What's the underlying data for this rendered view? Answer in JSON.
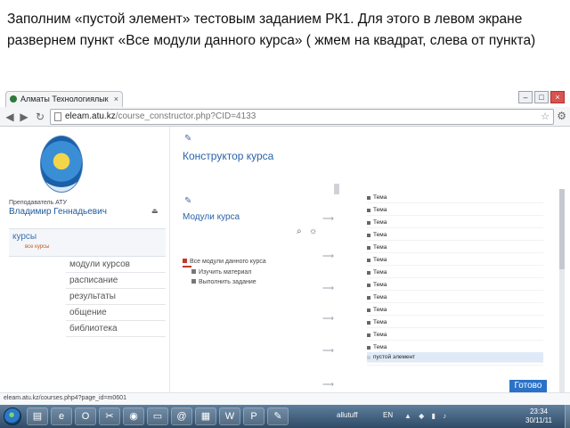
{
  "caption": {
    "line1": "Заполним «пустой элемент» тестовым заданием РК1. Для этого в левом экране",
    "line2": "развернем пункт «Все модули данного курса» (  жмем на квадрат, слева от пункта)"
  },
  "browser": {
    "tab_title": "Алматы Технологиялык",
    "url_host": "eleam.atu.kz",
    "url_path": "/course_constructor.php?CID=4133",
    "status_url": "eleam.atu.kz/courses.php4?page_id=m0601"
  },
  "left": {
    "teacher_label": "Преподаватель АТУ",
    "teacher_name": "Владимир Геннадьевич",
    "courses_title": "курсы",
    "courses_sub": "все курсы",
    "menu": [
      "модули курсов",
      "расписание",
      "результаты",
      "общение",
      "библиотека"
    ]
  },
  "middle": {
    "title": "Конструктор курса",
    "modules_title": "Модули курса",
    "tree": [
      "Все модули данного курса",
      "Изучить материал",
      "Выполнить задание"
    ]
  },
  "right": {
    "topics": [
      "Тема",
      "Тема",
      "Тема",
      "Тема",
      "Тема",
      "Тема",
      "Тема",
      "Тема",
      "Тема",
      "Тема",
      "Тема",
      "Тема",
      "Тема",
      "Тема"
    ],
    "empty_element": "пустой элемент",
    "done_button": "Готово"
  },
  "taskbar": {
    "user": "allutuff",
    "lang": "EN",
    "time": "23:34",
    "date": "30/11/11",
    "apps": [
      "explorer-icon",
      "ie-icon",
      "opera-icon",
      "tools-icon",
      "chrome-icon",
      "folder-icon",
      "mail-icon",
      "media-icon",
      "word-icon",
      "powerpoint-icon",
      "editor-icon"
    ]
  }
}
